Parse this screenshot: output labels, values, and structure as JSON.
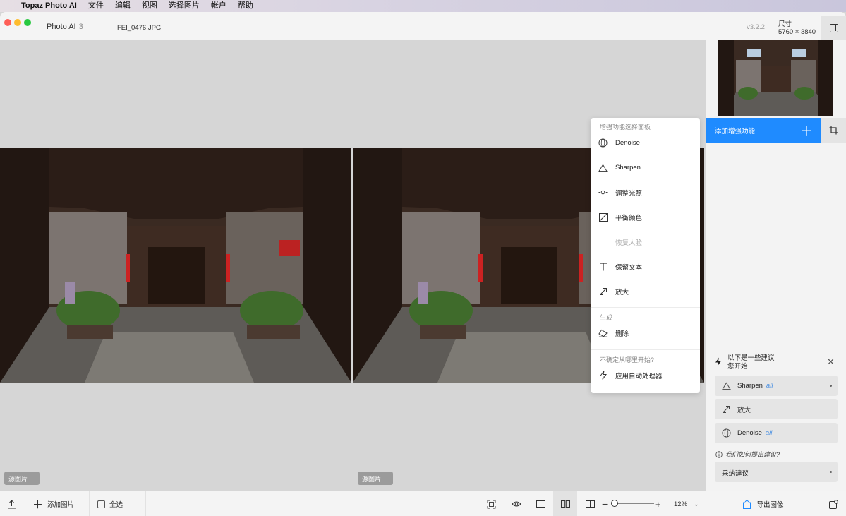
{
  "menubar": {
    "apple_icon": "apple-icon",
    "app_name": "Topaz Photo AI",
    "items": [
      "文件",
      "编辑",
      "视图",
      "选择图片",
      "帐户",
      "帮助"
    ]
  },
  "titlebar": {
    "app_tab": "Photo AI",
    "app_tab_count": "3",
    "file_tab": "FEI_0476.JPG",
    "version": "v3.2.2",
    "size_label": "尺寸",
    "size_value": "5760 × 3840"
  },
  "canvas": {
    "left_badge": "源图片",
    "right_badge": "源图片"
  },
  "popup": {
    "enhance_title": "增强功能选择面板",
    "enhance_items": [
      {
        "label": "Denoise",
        "icon": "globe-icon"
      },
      {
        "label": "Sharpen",
        "icon": "triangle-icon"
      },
      {
        "label": "调整光照",
        "icon": "sun-icon"
      },
      {
        "label": "平衡颜色",
        "icon": "color-balance-icon"
      },
      {
        "label": "恢复人脸",
        "icon": ""
      },
      {
        "label": "保留文本",
        "icon": "text-icon"
      },
      {
        "label": "放大",
        "icon": "expand-icon"
      }
    ],
    "generate_title": "生成",
    "generate_items": [
      {
        "label": "删除",
        "icon": "eraser-icon"
      }
    ],
    "unsure_title": "不确定从哪里开始?",
    "auto_label": "应用自动处理器"
  },
  "right_panel": {
    "add_enhancement": "添加增强功能",
    "suggestions_title_line1": "以下是一些建议",
    "suggestions_title_line2": "您开始...",
    "suggestions": [
      {
        "label": "Sharpen",
        "tag": "all",
        "icon": "triangle-icon"
      },
      {
        "label": "放大",
        "tag": "",
        "icon": "expand-icon"
      },
      {
        "label": "Denoise",
        "tag": "all",
        "icon": "globe-icon"
      }
    ],
    "how_link": "我们如何提出建议?",
    "adopt_label": "采纳建议"
  },
  "bottombar": {
    "add_image": "添加图片",
    "select_all": "全选",
    "zoom_level": "12%",
    "export_label": "导出图像"
  },
  "colors": {
    "accent": "#1f8bff",
    "suggestion_tag": "#4a90e2"
  }
}
